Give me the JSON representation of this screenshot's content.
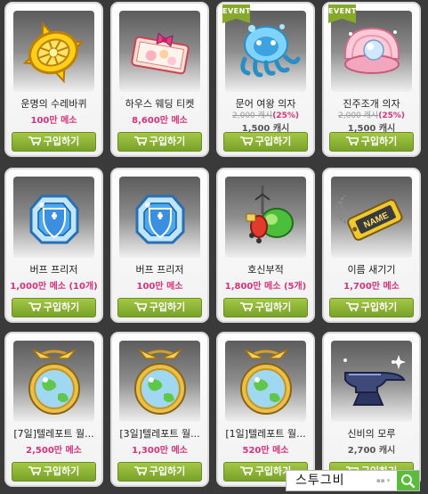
{
  "buy_label": "구입하기",
  "event_label": "EVENT",
  "search": {
    "value": "스투그비",
    "icon": "search-icon",
    "dropdown_icon": "chevron-down-icon"
  },
  "colors": {
    "price": "#d8337a",
    "button": "#86b034",
    "event_badge": "#86a82b",
    "search_button": "#5bbb3b"
  },
  "items": [
    {
      "name": "운명의 수레바퀴",
      "price": "100만 메소",
      "icon": "golden-wheel-icon"
    },
    {
      "name": "하우스 웨딩 티켓",
      "price": "8,600만 메소",
      "icon": "wedding-ticket-icon"
    },
    {
      "name": "문어 여왕 의자",
      "event": true,
      "original_price": "2,000 캐시",
      "discount": "(25%)",
      "price": "1,500 캐시",
      "icon": "octopus-chair-icon"
    },
    {
      "name": "진주조개 의자",
      "event": true,
      "original_price": "2,000 캐시",
      "discount": "(25%)",
      "price": "1,500 캐시",
      "icon": "pearl-clam-chair-icon"
    },
    {
      "name": "버프 프리저",
      "price": "1,000만 메소 (10개)",
      "icon": "buff-freezer-icon"
    },
    {
      "name": "버프 프리저",
      "price": "100만 메소",
      "icon": "buff-freezer-icon"
    },
    {
      "name": "호신부적",
      "price": "1,800만 메소 (5개)",
      "icon": "safety-charm-icon"
    },
    {
      "name": "이름 새기기",
      "price": "1,700만 메소",
      "icon": "name-tag-icon"
    },
    {
      "name": "[7일]텔레포트 월...",
      "price": "2,500만 메소",
      "icon": "teleport-world-map-icon"
    },
    {
      "name": "[3일]텔레포트 월...",
      "price": "1,300만 메소",
      "icon": "teleport-world-map-icon"
    },
    {
      "name": "[1일]텔레포트 월...",
      "price": "520만 메소",
      "icon": "teleport-world-map-icon"
    },
    {
      "name": "신비의 모루",
      "price": "2,700 캐시",
      "price_gray": true,
      "icon": "anvil-icon"
    }
  ]
}
